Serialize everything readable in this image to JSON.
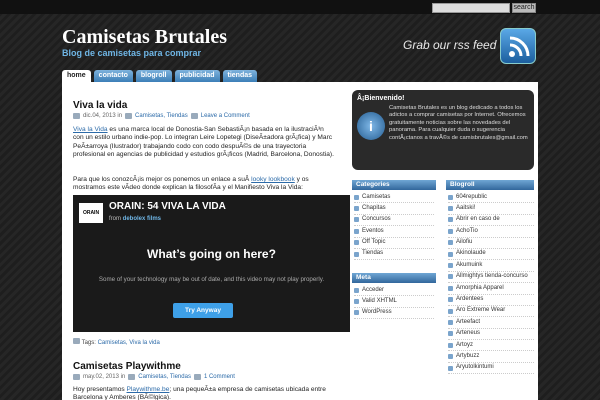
{
  "search": {
    "placeholder": "",
    "button": "search"
  },
  "site": {
    "title": "Camisetas Brutales",
    "tagline": "Blog de camisetas para comprar"
  },
  "rss": {
    "text": "Grab our rss feed"
  },
  "nav": [
    {
      "label": "home"
    },
    {
      "label": "contacto"
    },
    {
      "label": "blogroll"
    },
    {
      "label": "publicidad"
    },
    {
      "label": "tiendas"
    }
  ],
  "posts": [
    {
      "title": "Viva la vida",
      "date": "dic.04, 2013 in",
      "categories": "Camisetas, Tiendas",
      "comment": "Leave a Comment",
      "p1_link": "Viva la Vida",
      "p1_text": " es una marca local de Donostia-San SebastiÃ¡n basada en la ilustraciÃ³n con un estilo urbano indie-pop. Lo integran Leire Lopetegi (DiseÃ±adora grÃ¡fica) y Marc PeÃ±arroya (Ilustrador) trabajando codo con codo despuÃ©s de una trayectoria profesional en agencias de publicidad y estudios grÃ¡ficos (Madrid, Barcelona, Donostia).",
      "p2_a": "Para que los conozcÃ¡is mejor os ponemos un enlace a suÂ ",
      "p2_link": "looky lookbook",
      "p2_b": " y os mostramos este vÃ­deo donde explican la filosofÃ­a y el Manifiesto Viva la Vida:",
      "tags_label": "Tags:",
      "tags": "Camisetas, Viva la vida"
    },
    {
      "title": "Camisetas Playwithme",
      "date": "may.02, 2013 in",
      "categories": "Camisetas, Tiendas",
      "comment": "1 Comment",
      "p1_a": "Hoy presentamos ",
      "p1_link": "Playwithme.be",
      "p1_b": "; una pequeÃ±a empresa de camisetas ubicada entre Barcelona y Amberes (BÃ©lgica)."
    }
  ],
  "video": {
    "channel": "ORAIN",
    "title": "ORAIN: 54 VIVA LA VIDA",
    "from_prefix": "from",
    "from_name": "debolex films",
    "heading": "What’s going on here?",
    "body": "Some of your technology may be out of date, and this video may not play properly.",
    "button": "Try Anyway"
  },
  "welcome": {
    "title": "Â¡Bienvenido!",
    "text": "Camisetas Brutales es un blog dedicado a todos los adictos a comprar camisetas por Internet. Ofrecemos gratuitamente noticias sobre las novedades del panorama. Para cualquier duda o sugerencia contÃ¡ctanos a travÃ©s de camisbrutales@gmail.com"
  },
  "categories": {
    "title": "Categories",
    "items": [
      "Camisetas",
      "Chapitas",
      "Concursos",
      "Eventos",
      "Off Topic",
      "Tiendas"
    ]
  },
  "meta": {
    "title": "Meta",
    "items": [
      "Acceder",
      "Valid XHTML",
      "WordPress"
    ]
  },
  "blogroll": {
    "title": "Blogroll",
    "items": [
      "604republic",
      "Aaitski!",
      "Abrir en caso de",
      "AchoTio",
      "Ailofiu",
      "Akinolaude",
      "Akumuink",
      "Allmightys tienda-concurso",
      "Amorphia Apparel",
      "Ardentees",
      "Aro Extreme Wear",
      "Arteefact",
      "Arteneus",
      "Artoyz",
      "Artybuzz",
      "Aryutolkintumi"
    ]
  }
}
